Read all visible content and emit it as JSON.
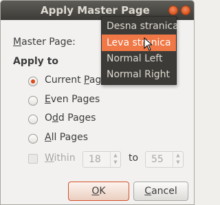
{
  "window": {
    "title": "Apply Master Page"
  },
  "form": {
    "master_page_label_pre": "M",
    "master_page_label_rest": "aster Page:",
    "apply_to_label": "Apply to",
    "options": [
      {
        "pre": "Current ",
        "ul": "P",
        "post": "age",
        "checked": true
      },
      {
        "pre": "",
        "ul": "E",
        "post": "ven Pages",
        "checked": false
      },
      {
        "pre": "O",
        "ul": "d",
        "post": "d Pages",
        "checked": false
      },
      {
        "pre": "",
        "ul": "A",
        "post": "ll Pages",
        "checked": false
      }
    ],
    "within": {
      "pre": "",
      "ul": "W",
      "post": "ithin"
    },
    "from_value": "18",
    "to_label": "to",
    "to_value": "55"
  },
  "buttons": {
    "ok_ul": "O",
    "ok_post": "K",
    "cancel_ul": "C",
    "cancel_post": "ancel"
  },
  "dropdown": {
    "items": [
      {
        "label": "Desna stranica",
        "selected": false
      },
      {
        "label": "Leva stranica",
        "selected": true
      },
      {
        "label": "Normal Left",
        "selected": false
      },
      {
        "label": "Normal Right",
        "selected": false
      }
    ]
  },
  "colors": {
    "accent": "#dd4814",
    "menu_highlight": "#f07746",
    "menu_bg": "#3c3b37"
  }
}
